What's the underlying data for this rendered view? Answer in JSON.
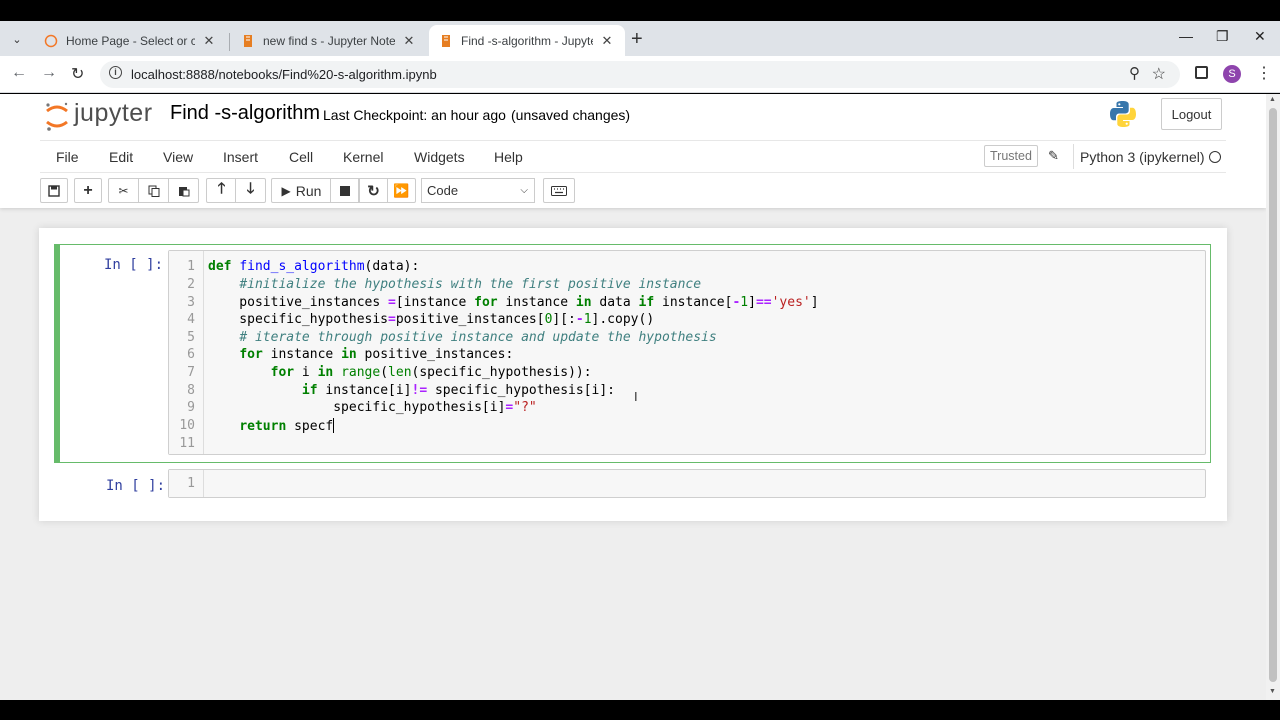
{
  "browser": {
    "tabs": [
      {
        "title": "Home Page - Select or create a",
        "active": false
      },
      {
        "title": "new find s - Jupyter Notebook",
        "active": false
      },
      {
        "title": "Find -s-algorithm - Jupyter Not",
        "active": true
      }
    ],
    "new_tab": "+",
    "window_controls": {
      "minimize": "—",
      "maximize": "❐",
      "close": "✕"
    },
    "url": "localhost:8888/notebooks/Find%20-s-algorithm.ipynb",
    "profile_initial": "S"
  },
  "header": {
    "logo_text": "jupyter",
    "notebook_title": "Find -s-algorithm",
    "checkpoint": "Last Checkpoint: an hour ago",
    "unsaved": "(unsaved changes)",
    "logout": "Logout"
  },
  "menu": {
    "items": [
      "File",
      "Edit",
      "View",
      "Insert",
      "Cell",
      "Kernel",
      "Widgets",
      "Help"
    ],
    "trusted": "Trusted",
    "kernel": "Python 3 (ipykernel)"
  },
  "toolbar": {
    "run_label": "Run",
    "cell_type": "Code"
  },
  "cells": [
    {
      "prompt": "In [ ]:",
      "line_numbers": [
        "1",
        "2",
        "3",
        "4",
        "5",
        "6",
        "7",
        "8",
        "9",
        "10",
        "11"
      ]
    },
    {
      "prompt": "In [ ]:",
      "line_numbers": [
        "1"
      ]
    }
  ],
  "colors": {
    "edit_border": "#66bb6a",
    "prompt": "#303f9f",
    "keyword": "#008000",
    "comment": "#408080",
    "string": "#ba2121"
  }
}
